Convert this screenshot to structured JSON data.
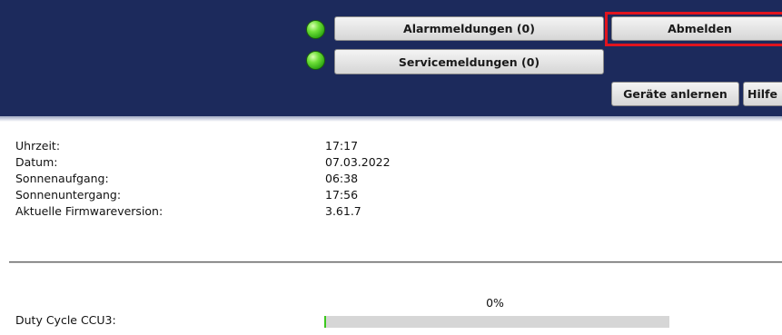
{
  "header": {
    "alarm_button": "Alarmmeldungen (0)",
    "service_button": "Servicemeldungen (0)",
    "logout_button": "Abmelden",
    "pair_button": "Geräte anlernen",
    "help_button": "Hilfe",
    "status_color": "#3cc81e"
  },
  "info": {
    "rows": [
      {
        "label": "Uhrzeit:",
        "value": "17:17"
      },
      {
        "label": "Datum:",
        "value": "07.03.2022"
      },
      {
        "label": "Sonnenaufgang:",
        "value": "06:38"
      },
      {
        "label": "Sonnenuntergang:",
        "value": "17:56"
      },
      {
        "label": "Aktuelle Firmwareversion:",
        "value": "3.61.7"
      }
    ]
  },
  "duty_cycle": {
    "label": "Duty Cycle CCU3:",
    "percent_text": "0%",
    "value": 0
  },
  "colors": {
    "header_bg": "#1c2a5c",
    "focus_border": "#e0141e"
  }
}
